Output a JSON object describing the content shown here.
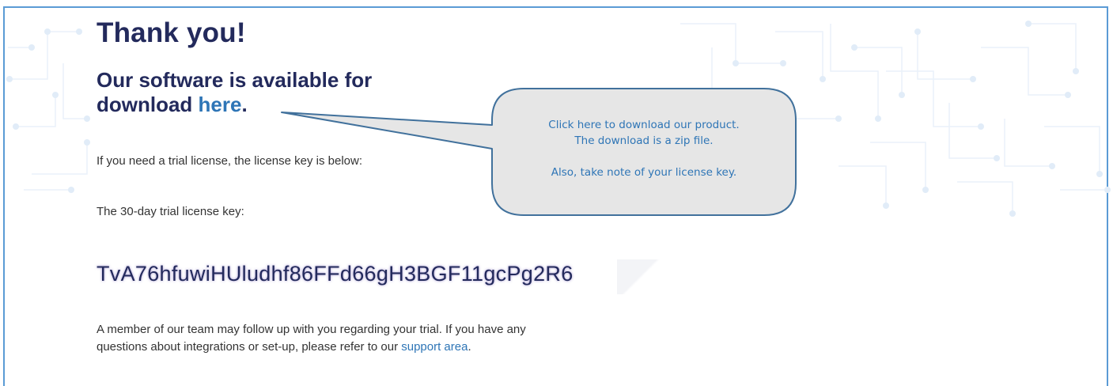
{
  "heading": {
    "title": "Thank you!",
    "subtitle_before": "Our software is available for download ",
    "subtitle_link": "here",
    "subtitle_after": "."
  },
  "trial": {
    "intro_text": "If you need a trial license, the license key is below:",
    "key_label": "The 30-day trial license key:",
    "license_key": "TvA76hfuwiHUludhf86FFd66gH3BGF11gcPg2R6"
  },
  "followup": {
    "text": "A member of our team may follow up with you regarding your trial. If you have any questions about integrations or set-up, please refer to our ",
    "link": "support area",
    "after": "."
  },
  "callout": {
    "line1": "Click here to download our product.",
    "line2": "The download is a zip file.",
    "line3": "Also, take note of your license key."
  },
  "colors": {
    "heading": "#232a5c",
    "link": "#2e75b6",
    "border": "#5b9bd5",
    "callout_fill": "#e6e6e6",
    "callout_stroke": "#41719c"
  }
}
